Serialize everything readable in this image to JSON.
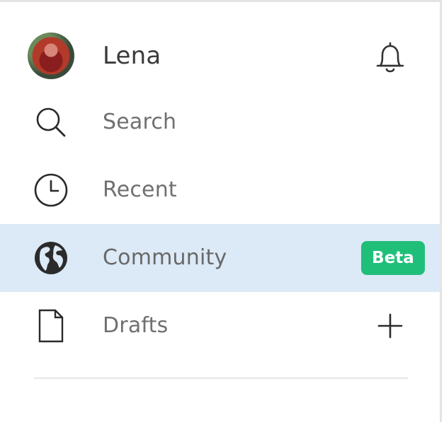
{
  "user": {
    "name": "Lena"
  },
  "nav": {
    "items": [
      {
        "label": "Search",
        "icon": "search-icon"
      },
      {
        "label": "Recent",
        "icon": "clock-icon"
      },
      {
        "label": "Community",
        "icon": "globe-icon",
        "badge": "Beta",
        "active": true
      },
      {
        "label": "Drafts",
        "icon": "file-icon"
      }
    ]
  },
  "colors": {
    "active_bg": "#dce9f6",
    "badge_bg": "#1fbf7a"
  }
}
